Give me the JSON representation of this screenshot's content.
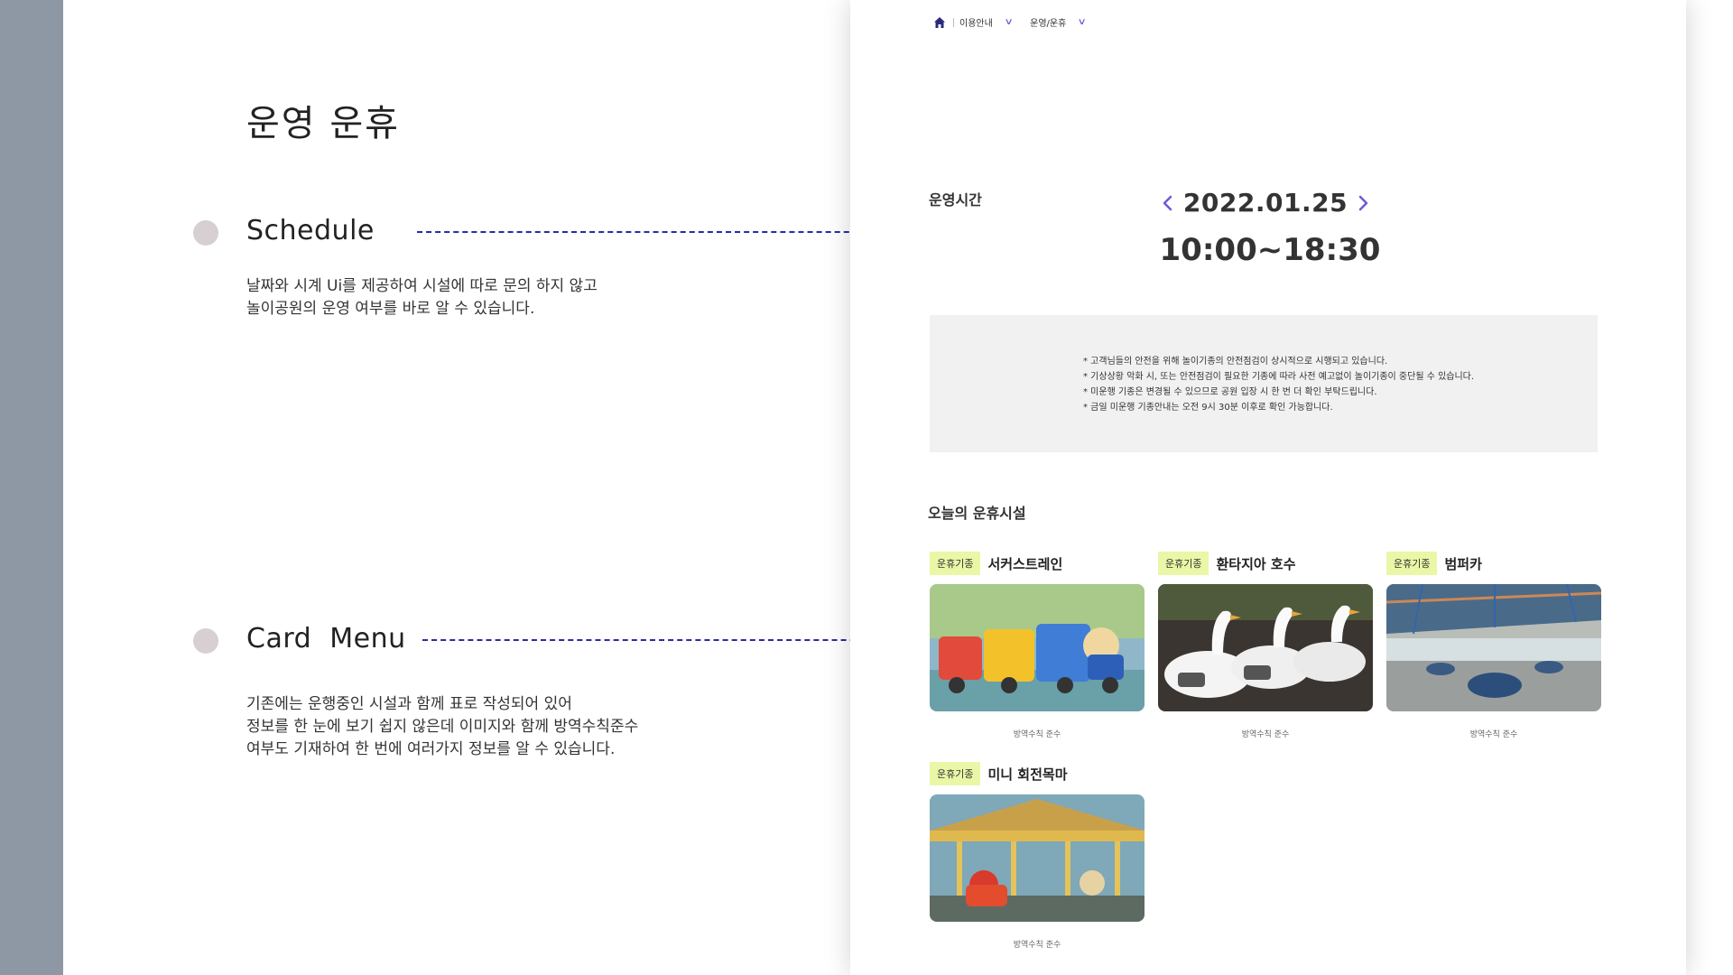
{
  "page": {
    "title": "운영 운휴"
  },
  "features": [
    {
      "title": "Schedule",
      "desc": [
        "날짜와 시계 Ui를 제공하여 시설에 따로 문의 하지 않고",
        "놀이공원의 운영 여부를 바로 알 수 있습니다."
      ]
    },
    {
      "title": "Card  Menu",
      "desc": [
        "기존에는 운행중인 시설과 함께 표로 작성되어 있어",
        "정보를 한 눈에 보기 쉽지 않은데 이미지와 함께 방역수칙준수",
        "여부도 기재하여 한 번에 여러가지 정보를 알 수 있습니다."
      ]
    }
  ],
  "mock": {
    "breadcrumb": {
      "level1": "이용안내",
      "level2": "운영/운휴"
    },
    "schedule": {
      "label": "운영시간",
      "date": "2022.01.25",
      "time": "10:00~18:30"
    },
    "notices": [
      "* 고객님들의 안전을 위해 놀이기종의 안전점검이 상시적으로 시행되고 있습니다.",
      "* 기상상황 악화 시, 또는 안전점검이 필요한 기종에 따라 사전 예고없이 놀이기종이 중단될 수 있습니다.",
      "* 미운행 기종은 변경될 수 있으므로 공원 입장 시 한 번 더 확인 부탁드립니다.",
      "* 금일 미운행 기종안내는 오전 9시 30분 이후로 확인 가능합니다."
    ],
    "section_title": "오늘의 운휴시설",
    "cards": [
      {
        "badge": "운휴기종",
        "name": "서커스트레인",
        "note": "방역수칙 준수"
      },
      {
        "badge": "운휴기종",
        "name": "환타지아 호수",
        "note": "방역수칙 준수"
      },
      {
        "badge": "운휴기종",
        "name": "범퍼카",
        "note": "방역수칙 준수"
      },
      {
        "badge": "운휴기종",
        "name": "미니 회전목마",
        "note": "방역수칙 준수"
      }
    ],
    "colors": {
      "accent": "#6a5bd8",
      "badge": "#eaf7a6",
      "connector": "#1b1b9a"
    }
  }
}
